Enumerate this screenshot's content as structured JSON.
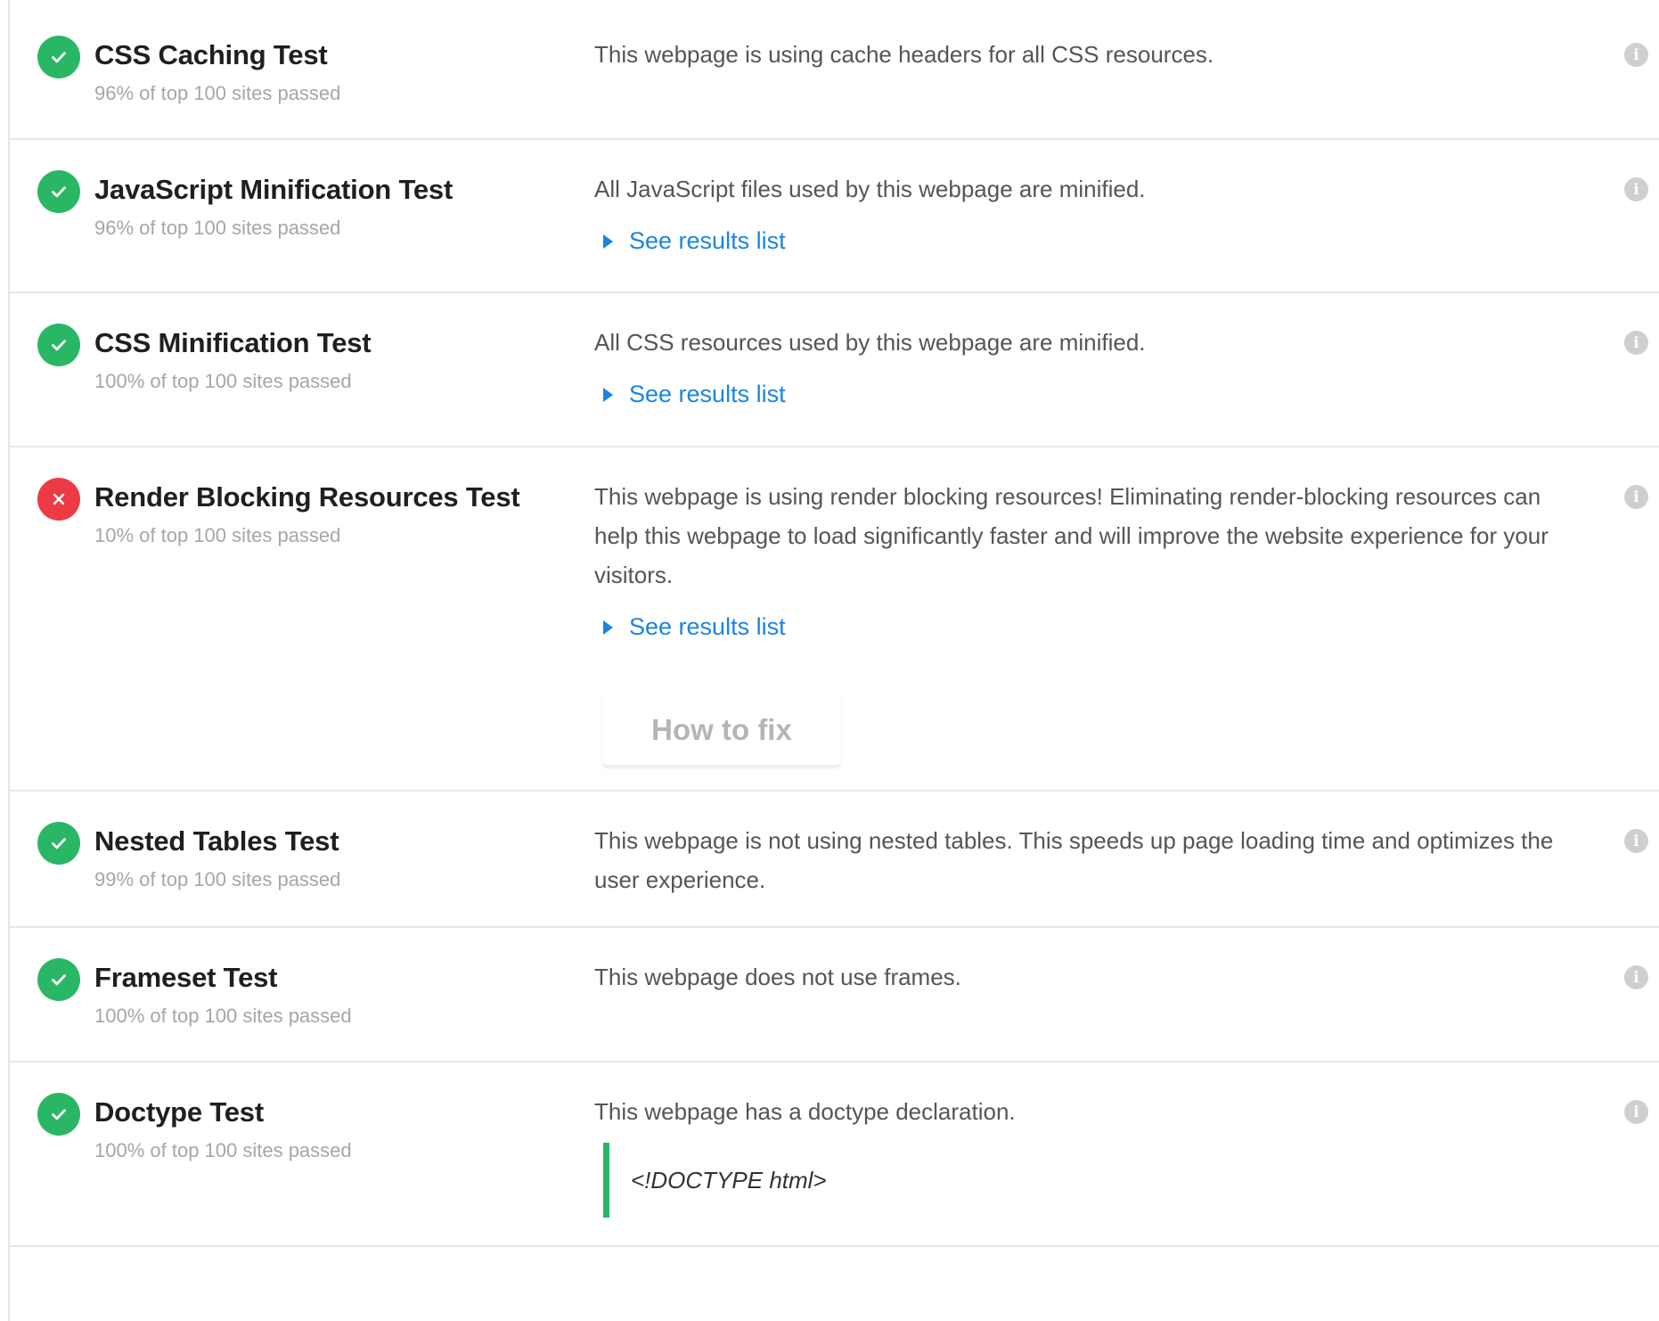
{
  "colors": {
    "pass": "#29b765",
    "fail": "#ee3a45",
    "link": "#1a84e5",
    "subtitle": "#a6a6a6",
    "divider": "#e6e6e6"
  },
  "info_icon_glyph": "i",
  "tests": [
    {
      "status": "pass",
      "status_icon": "check-icon",
      "title": "CSS Caching Test",
      "subtitle": "96% of top 100 sites passed",
      "description": "This webpage is using cache headers for all CSS resources."
    },
    {
      "status": "pass",
      "status_icon": "check-icon",
      "title": "JavaScript Minification Test",
      "subtitle": "96% of top 100 sites passed",
      "description": "All JavaScript files used by this webpage are minified.",
      "link": "See results list"
    },
    {
      "status": "pass",
      "status_icon": "check-icon",
      "title": "CSS Minification Test",
      "subtitle": "100% of top 100 sites passed",
      "description": "All CSS resources used by this webpage are minified.",
      "link": "See results list"
    },
    {
      "status": "fail",
      "status_icon": "cross-icon",
      "title": "Render Blocking Resources Test",
      "subtitle": "10% of top 100 sites passed",
      "description": "This webpage is using render blocking resources! Eliminating render-blocking resources can help this webpage to load significantly faster and will improve the website experience for your visitors.",
      "link": "See results list",
      "button": "How to fix"
    },
    {
      "status": "pass",
      "status_icon": "check-icon",
      "title": "Nested Tables Test",
      "subtitle": "99% of top 100 sites passed",
      "description": "This webpage is not using nested tables. This speeds up page loading time and optimizes the user experience."
    },
    {
      "status": "pass",
      "status_icon": "check-icon",
      "title": "Frameset Test",
      "subtitle": "100% of top 100 sites passed",
      "description": "This webpage does not use frames."
    },
    {
      "status": "pass",
      "status_icon": "check-icon",
      "title": "Doctype Test",
      "subtitle": "100% of top 100 sites passed",
      "description": "This webpage has a doctype declaration.",
      "code": "<!DOCTYPE html>"
    }
  ]
}
